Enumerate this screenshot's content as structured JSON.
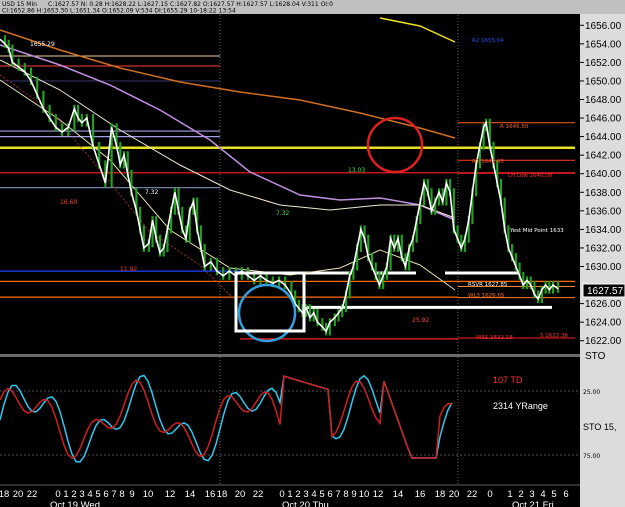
{
  "header": {
    "symbol": "USD 15 Min",
    "quote": "C:1627.57  N: 0.28  H:1628.22  L:1627.15  C:1627.82  O:1627.57  H:1627.57  L:1628.04  V:311  OI:0",
    "quote2": "CI:1652.86  H:1653.30  L:1651.34  O:1652.09  V:534  DI:1655.29  10-18:22  13:54"
  },
  "chart_data": {
    "type": "candlestick",
    "ylim": [
      1621,
      1657
    ],
    "y_ticks": [
      "1622.00",
      "1624.00",
      "1626.00",
      "1628.00",
      "1630.00",
      "1632.00",
      "1634.00",
      "1636.00",
      "1638.00",
      "1640.00",
      "1642.00",
      "1644.00",
      "1646.00",
      "1648.00",
      "1650.00",
      "1652.00",
      "1654.00",
      "1656.00"
    ],
    "last_price": "1627.57",
    "x_ticks": [
      "18",
      "20",
      "22",
      "0",
      "1",
      "2",
      "3",
      "4",
      "5",
      "6",
      "7",
      "8",
      "9",
      "10",
      "12",
      "14",
      "16",
      "18",
      "20",
      "22",
      "0",
      "1",
      "2",
      "3",
      "4",
      "5",
      "6",
      "7",
      "8",
      "9",
      "10",
      "12",
      "14",
      "16",
      "18",
      "20",
      "22",
      "0",
      "1",
      "2",
      "3",
      "4",
      "5",
      "6"
    ],
    "x_day_labels": [
      "Oct 19 Wed",
      "Oct 20 Thu",
      "Oct 21 Fri"
    ],
    "price_path": [
      [
        0,
        1654.5
      ],
      [
        4,
        1654
      ],
      [
        7,
        1653.5
      ],
      [
        10,
        1652
      ],
      [
        15,
        1651.5
      ],
      [
        20,
        1651
      ],
      [
        25,
        1650
      ],
      [
        30,
        1648.5
      ],
      [
        35,
        1647
      ],
      [
        40,
        1646
      ],
      [
        45,
        1645
      ],
      [
        50,
        1644.5
      ],
      [
        55,
        1645
      ],
      [
        60,
        1647
      ],
      [
        63,
        1646
      ],
      [
        66,
        1645.5
      ],
      [
        70,
        1646
      ],
      [
        75,
        1643
      ],
      [
        80,
        1641
      ],
      [
        85,
        1639
      ],
      [
        90,
        1645
      ],
      [
        94,
        1643
      ],
      [
        97,
        1641
      ],
      [
        100,
        1642
      ],
      [
        103,
        1640
      ],
      [
        106,
        1638
      ],
      [
        110,
        1636
      ],
      [
        113,
        1634
      ],
      [
        116,
        1632
      ],
      [
        120,
        1632.5
      ],
      [
        123,
        1635
      ],
      [
        126,
        1633
      ],
      [
        129,
        1631.5
      ],
      [
        132,
        1632
      ],
      [
        135,
        1634
      ],
      [
        138,
        1636
      ],
      [
        141,
        1638
      ],
      [
        144,
        1636
      ],
      [
        147,
        1634
      ],
      [
        150,
        1633
      ],
      [
        153,
        1636
      ],
      [
        156,
        1637
      ],
      [
        159,
        1634
      ],
      [
        162,
        1632
      ],
      [
        165,
        1630
      ],
      [
        170,
        1630.5
      ],
      [
        175,
        1629.5
      ],
      [
        180,
        1629
      ],
      [
        185,
        1629.5
      ],
      [
        190,
        1629
      ],
      [
        195,
        1629.5
      ],
      [
        200,
        1629
      ],
      [
        205,
        1628.5
      ],
      [
        210,
        1629
      ],
      [
        215,
        1628.5
      ],
      [
        220,
        1628.2
      ],
      [
        225,
        1628.5
      ],
      [
        230,
        1628
      ],
      [
        235,
        1627
      ],
      [
        238,
        1626
      ],
      [
        241,
        1625.5
      ],
      [
        244,
        1625
      ],
      [
        247,
        1625.5
      ],
      [
        250,
        1624.5
      ],
      [
        253,
        1625
      ],
      [
        256,
        1624
      ],
      [
        260,
        1623.5
      ],
      [
        263,
        1623
      ],
      [
        266,
        1624
      ],
      [
        270,
        1624.5
      ],
      [
        273,
        1625
      ],
      [
        276,
        1625.5
      ],
      [
        279,
        1627
      ],
      [
        282,
        1629
      ],
      [
        285,
        1630
      ],
      [
        288,
        1632
      ],
      [
        291,
        1634
      ],
      [
        294,
        1633
      ],
      [
        297,
        1631
      ],
      [
        300,
        1630
      ],
      [
        303,
        1629
      ],
      [
        306,
        1628
      ],
      [
        309,
        1629
      ],
      [
        312,
        1630
      ],
      [
        315,
        1633
      ],
      [
        318,
        1632
      ],
      [
        321,
        1633
      ],
      [
        324,
        1631
      ],
      [
        327,
        1630
      ],
      [
        330,
        1632
      ],
      [
        333,
        1633
      ],
      [
        336,
        1635
      ],
      [
        339,
        1637
      ],
      [
        342,
        1639
      ],
      [
        345,
        1638
      ],
      [
        348,
        1636
      ],
      [
        351,
        1637
      ],
      [
        354,
        1638
      ],
      [
        357,
        1637
      ],
      [
        360,
        1639
      ],
      [
        363,
        1638
      ],
      [
        366,
        1634
      ],
      [
        369,
        1633
      ],
      [
        372,
        1632
      ],
      [
        375,
        1633
      ],
      [
        378,
        1635
      ],
      [
        381,
        1638
      ],
      [
        384,
        1641
      ],
      [
        387,
        1643
      ],
      [
        390,
        1645
      ],
      [
        392,
        1645.5
      ],
      [
        395,
        1643
      ],
      [
        398,
        1641
      ],
      [
        401,
        1639
      ],
      [
        404,
        1637
      ],
      [
        407,
        1634
      ],
      [
        410,
        1632
      ],
      [
        413,
        1631
      ],
      [
        416,
        1630
      ],
      [
        419,
        1629
      ],
      [
        422,
        1628
      ],
      [
        425,
        1628.5
      ],
      [
        428,
        1628
      ],
      [
        431,
        1627
      ],
      [
        434,
        1626.5
      ],
      [
        437,
        1627.5
      ],
      [
        440,
        1628
      ],
      [
        443,
        1627.5
      ],
      [
        446,
        1628
      ],
      [
        450,
        1627.6
      ]
    ],
    "price_lines": [
      {
        "label": "R2 1655.04",
        "value": 1655.04,
        "color": "#2050ff"
      },
      {
        "label": "R 1645.50",
        "value": 1645.5,
        "color": "#ff6020"
      },
      {
        "label": "R1 1641.45",
        "value": 1641.45,
        "color": "#ff4020"
      },
      {
        "label": "LH Low 1640.08",
        "value": 1640.08,
        "color": "#ff3030"
      },
      {
        "label": "Yest Mid Point 1633",
        "value": 1633.5,
        "color": "#ffffff"
      },
      {
        "label": "WL3 1626.65",
        "value": 1626.65,
        "color": "#ff6a00"
      },
      {
        "label": "RSVR 1627.85",
        "value": 1627.85,
        "color": "#ffffff"
      },
      {
        "label": "WS1 1622.18",
        "value": 1622.18,
        "color": "#ff3030"
      },
      {
        "label": "S 1622.36",
        "value": 1622.36,
        "color": "#ff3030"
      }
    ],
    "annotations": [
      "1655.29",
      "7.32",
      "16.60",
      "13.03",
      "25.92",
      "11.92",
      "7.32"
    ],
    "osc": {
      "labels": [
        "107 TD",
        "2314 YRange",
        "STO 15,"
      ],
      "levels": [
        "25.00",
        "75.00"
      ]
    },
    "colors": {
      "candle": "#22a022",
      "price_line": "#ffffff",
      "ma_orange": "#d07020",
      "ma_violet": "#c090e0",
      "ma_yellow": "#e8e020",
      "sto_fast": "#30c8f0",
      "sto_slow": "#d02020",
      "circle_red": "#e02020",
      "circle_blue": "#30a0e0"
    }
  }
}
